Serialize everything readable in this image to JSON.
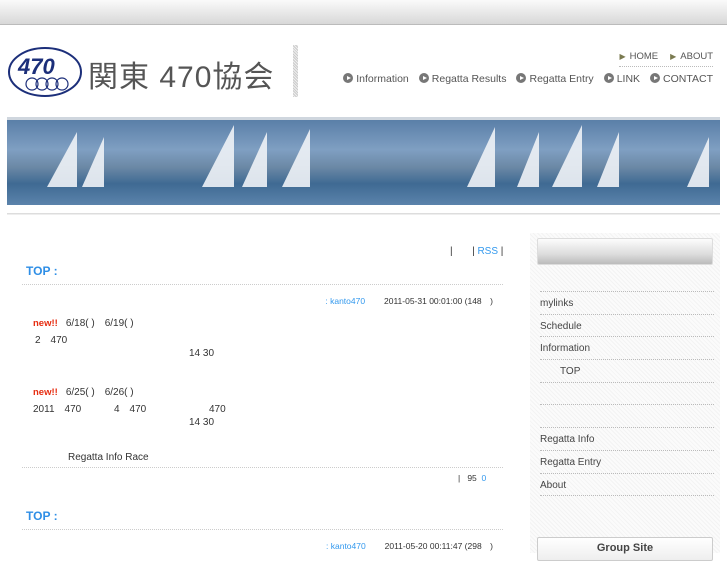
{
  "header": {
    "title": "関東 470協会",
    "logo_text": "470",
    "subnav": [
      "HOME",
      "ABOUT"
    ],
    "nav": [
      "Information",
      "Regatta Results",
      "Regatta Entry",
      "LINK",
      "CONTACT"
    ]
  },
  "toolbar": {
    "sep1": "|",
    "sep2": "|",
    "rss": "RSS",
    "sep3": "|"
  },
  "posts": [
    {
      "title": "TOP :",
      "author": ": kanto470",
      "date": "2011-05-31 00:01:00 (148　)",
      "lines": {
        "new1": "new!!",
        "l1": "6/18( )　6/19( )",
        "l2": "2　470",
        "l3": "14 30",
        "new2": "new!!",
        "l4": "6/25( )　6/26( )",
        "l5": "2011　470　　　 4　470　　　　　　 470",
        "l6": "14 30",
        "link": "Regatta Info Race"
      },
      "footer_sep": "|",
      "footer_count": "95",
      "footer_link": "0"
    },
    {
      "title": "TOP :",
      "author": ": kanto470",
      "date": "2011-05-20 00:11:47 (298　)"
    }
  ],
  "sidebar": {
    "items": [
      "mylinks",
      "Schedule",
      "Information",
      "TOP",
      "",
      "",
      "Regatta Info",
      "Regatta Entry",
      "About",
      ""
    ],
    "section2": "Group Site"
  }
}
